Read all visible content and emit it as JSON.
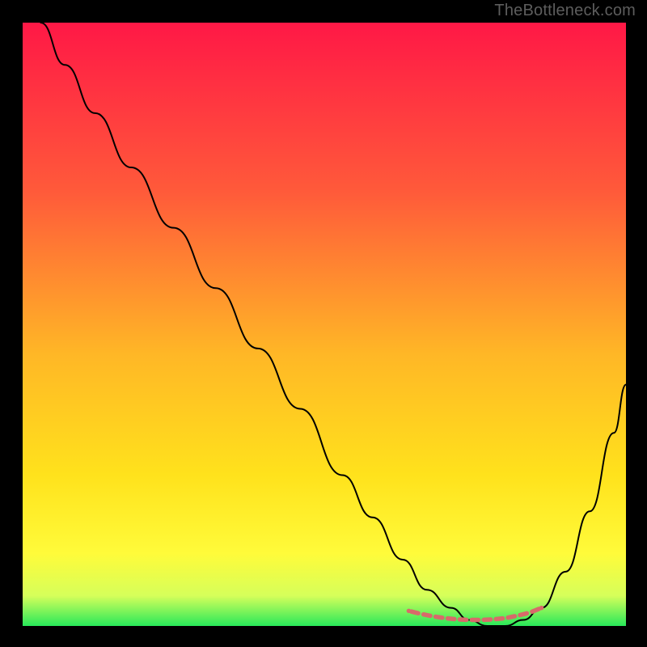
{
  "watermark": "TheBottleneck.com",
  "chart_data": {
    "type": "line",
    "title": "",
    "xlabel": "",
    "ylabel": "",
    "xlim": [
      0,
      100
    ],
    "ylim": [
      0,
      100
    ],
    "grid": false,
    "legend": false,
    "background_gradient": {
      "stops": [
        {
          "offset": 0.0,
          "color": "#ff1846"
        },
        {
          "offset": 0.28,
          "color": "#ff5a3a"
        },
        {
          "offset": 0.55,
          "color": "#ffb726"
        },
        {
          "offset": 0.75,
          "color": "#ffe21c"
        },
        {
          "offset": 0.88,
          "color": "#fffb3a"
        },
        {
          "offset": 0.95,
          "color": "#d6ff5a"
        },
        {
          "offset": 1.0,
          "color": "#28e85a"
        }
      ]
    },
    "series": [
      {
        "name": "bottleneck-curve",
        "stroke": "#000000",
        "stroke_width": 2,
        "x": [
          3,
          7,
          12,
          18,
          25,
          32,
          39,
          46,
          53,
          58,
          63,
          67,
          71,
          74,
          77,
          80,
          83,
          86,
          90,
          94,
          98,
          100
        ],
        "values": [
          100,
          93,
          85,
          76,
          66,
          56,
          46,
          36,
          25,
          18,
          11,
          6,
          3,
          1,
          0,
          0,
          1,
          3,
          9,
          19,
          32,
          40
        ]
      },
      {
        "name": "optimal-range-marker",
        "stroke": "#d86a6a",
        "stroke_width": 5.5,
        "style": "segmented",
        "x": [
          64,
          66,
          68,
          70,
          72,
          74,
          76,
          78,
          80,
          82,
          84,
          86
        ],
        "values": [
          2.5,
          2.0,
          1.6,
          1.3,
          1.1,
          1.0,
          1.0,
          1.1,
          1.3,
          1.7,
          2.2,
          3.0
        ]
      }
    ]
  }
}
